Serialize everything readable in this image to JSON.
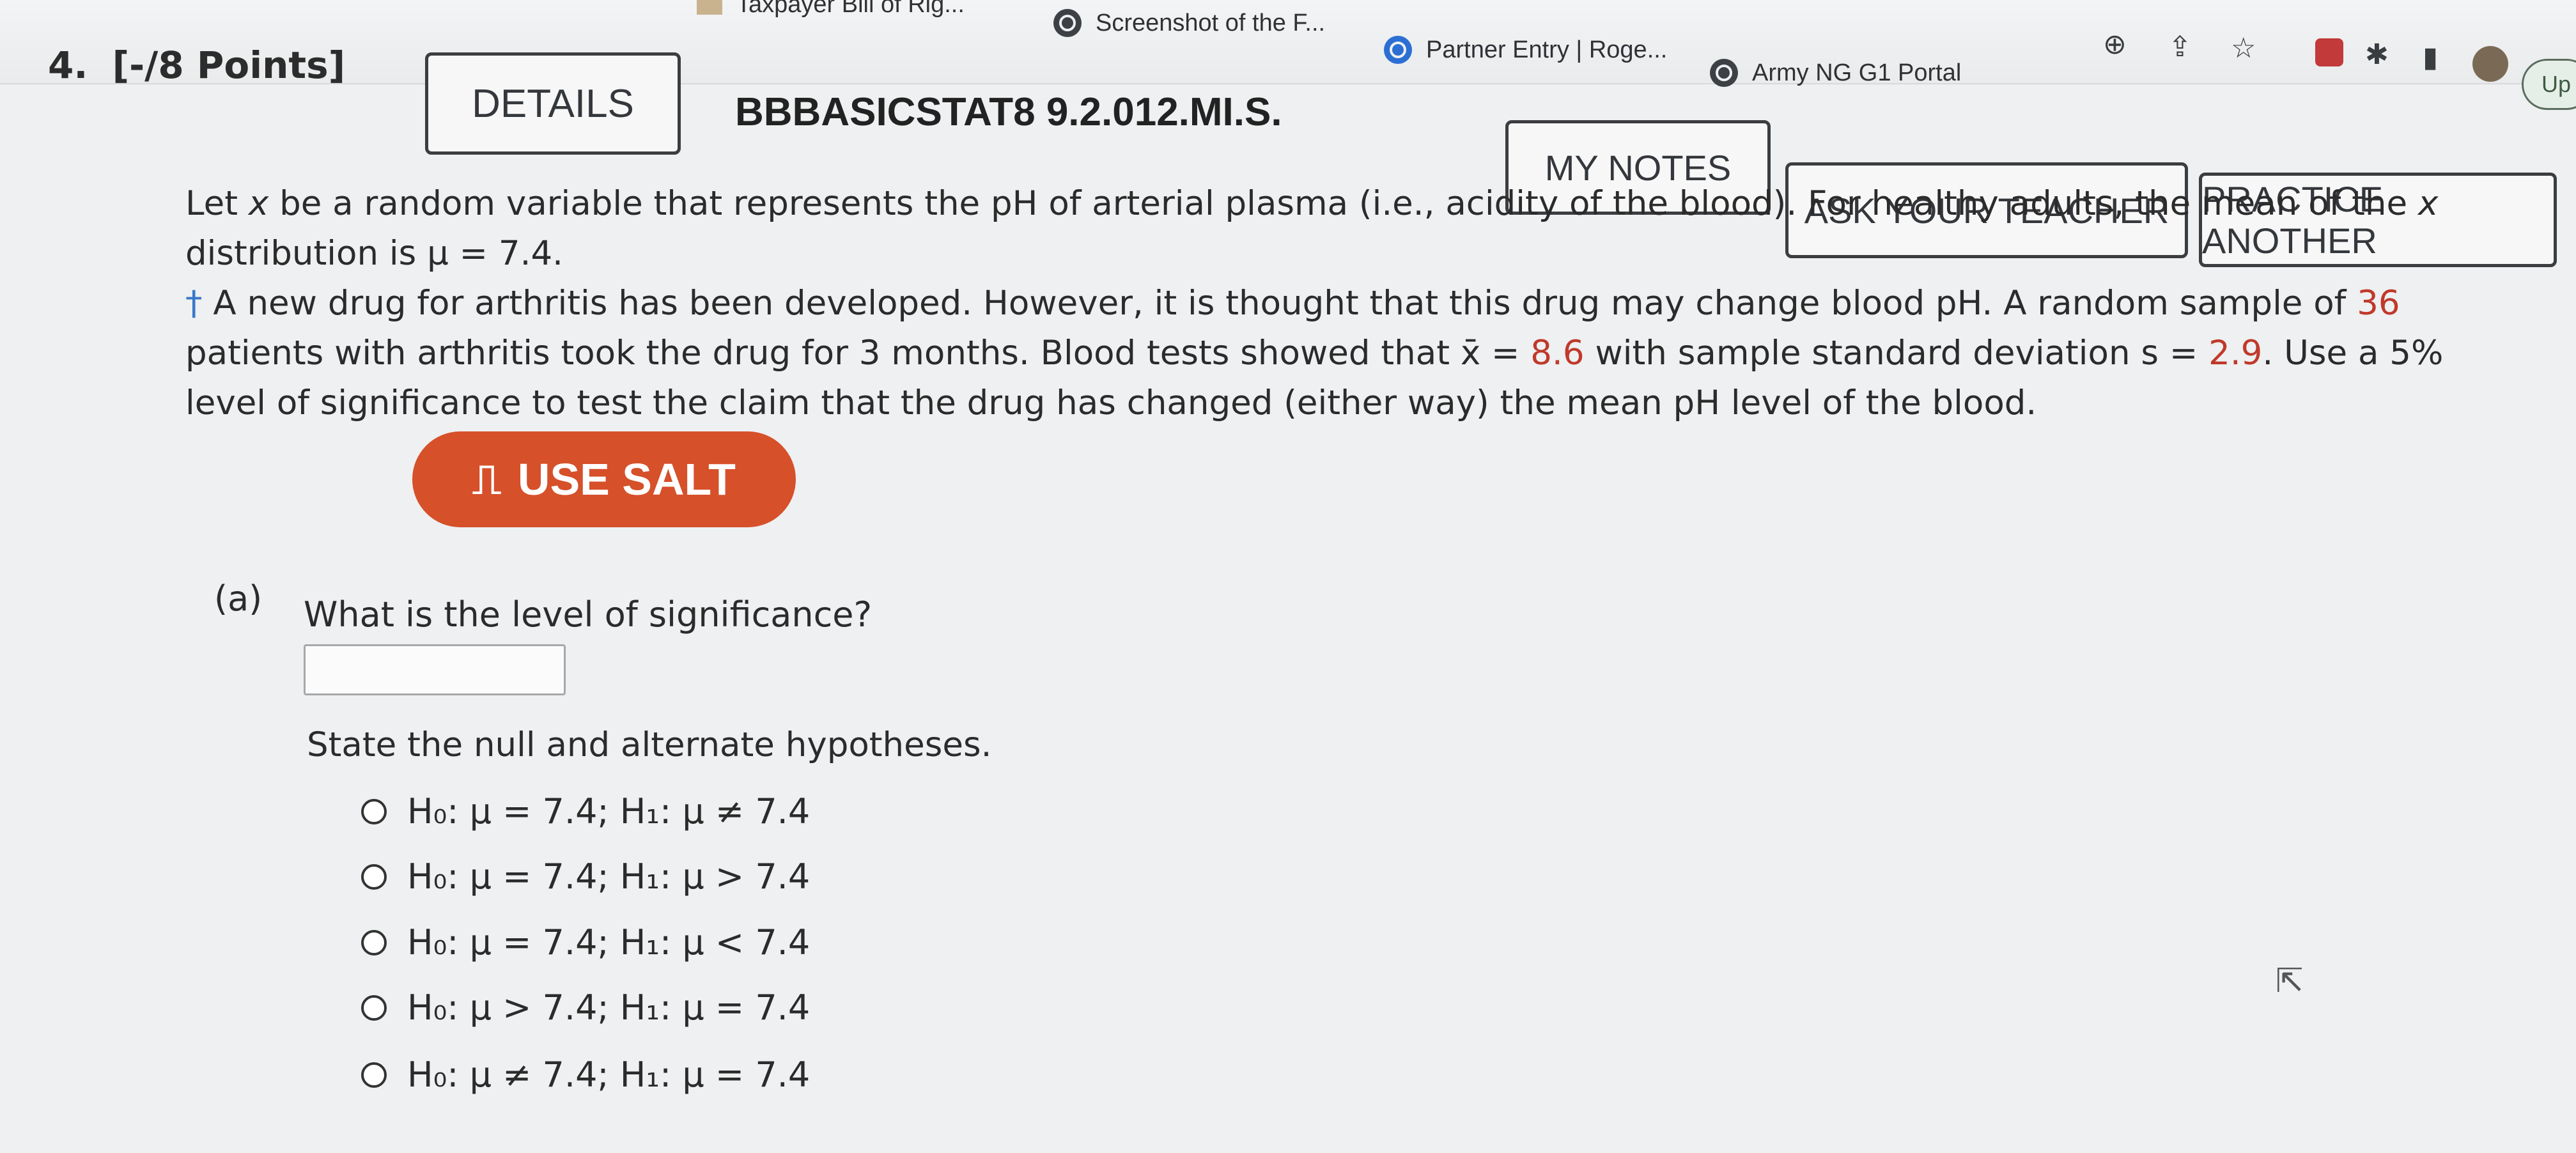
{
  "browser": {
    "bookmarks": [
      {
        "label": "Taxpayer Bill of Rig...",
        "icon": "document-icon"
      },
      {
        "label": "Screenshot of the F...",
        "icon": "globe-icon"
      },
      {
        "label": "Partner Entry | Roge...",
        "icon": "partner-icon"
      },
      {
        "label": "Army NG G1 Portal",
        "icon": "globe-icon"
      }
    ],
    "update_label": "Up"
  },
  "question": {
    "number": "4.",
    "points": "[-/8 Points]",
    "details_label": "DETAILS",
    "code": "BBBASICSTAT8 9.2.012.MI.S.",
    "my_notes_label": "MY NOTES",
    "ask_teacher_label": "ASK YOUR TEACHER",
    "practice_label": "PRACTICE ANOTHER"
  },
  "problem": {
    "p1": "Let ",
    "x1": "x",
    "p2": " be a random variable that represents the pH of arterial plasma (i.e., acidity of the blood). For healthy adults, the mean of the ",
    "x2": "x",
    "p3": " distribution is μ = 7.4.",
    "dagger": "†",
    "p4": " A new drug for arthritis has been developed. However, it is thought that this drug may change blood pH. A random sample of ",
    "n": "36",
    "p5": " patients with arthritis took the drug for 3 months. Blood tests showed that x̄ = ",
    "xbar": "8.6",
    "p6": " with sample standard deviation s = ",
    "s": "2.9",
    "p7": ". Use a 5% level of significance to test the claim that the drug has changed (either way) the mean pH level of the blood."
  },
  "salt_label": "USE SALT",
  "part_a": {
    "label": "(a)",
    "question": "What is the level of significance?",
    "answer_value": "",
    "hypotheses_prompt": "State the null and alternate hypotheses.",
    "options": [
      "H₀: μ = 7.4; H₁: μ ≠ 7.4",
      "H₀: μ = 7.4; H₁: μ > 7.4",
      "H₀: μ = 7.4; H₁: μ < 7.4",
      "H₀: μ > 7.4; H₁: μ = 7.4",
      "H₀: μ ≠ 7.4; H₁: μ = 7.4"
    ]
  },
  "colors": {
    "accent_salt": "#d6502a",
    "given_values": "#c0392b",
    "dagger": "#3a78c8"
  }
}
